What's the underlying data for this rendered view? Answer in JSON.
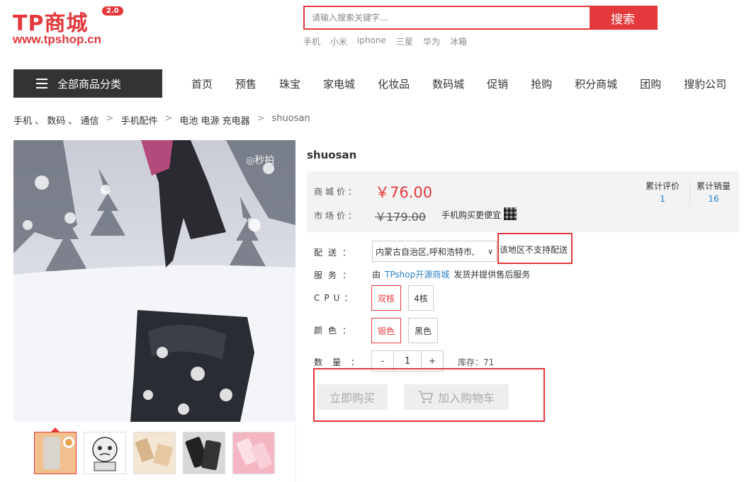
{
  "logo": {
    "title": "TP商城",
    "badge": "2.0",
    "url": "www.tpshop.cn"
  },
  "search": {
    "placeholder": "请输入搜索关键字...",
    "button": "搜索",
    "hot_words": [
      "手机",
      "小米",
      "iphone",
      "三星",
      "华为",
      "冰箱"
    ]
  },
  "nav": {
    "all_categories": "全部商品分类",
    "items": [
      "首页",
      "预售",
      "珠宝",
      "家电城",
      "化妆品",
      "数码城",
      "促销",
      "抢购",
      "积分商城",
      "团购",
      "搜豹公司"
    ]
  },
  "breadcrumb": [
    "手机 、 数码 、 通信",
    "手机配件",
    "电池 电源 充电器",
    "shuosan"
  ],
  "thumbnail_arrow_icon": "triangle-up-icon",
  "product": {
    "title": "shuosan",
    "shop_price_label": "商城价：",
    "shop_price": "￥76.00",
    "market_price_label": "市场价：",
    "market_price": "￥179.00",
    "mobile_cheap": "手机购买更便宜",
    "review_label": "累计评价",
    "review_count": "1",
    "sales_label": "累计销量",
    "sales_count": "16",
    "delivery_label": "配送：",
    "delivery_address": "内蒙古自治区,呼和浩特市,",
    "no_delivery": "该地区不支持配送",
    "service_label": "服务：",
    "service_prefix": "由",
    "service_link": "TPshop开源商城",
    "service_suffix": "发货并提供售后服务",
    "cpu_label": "CPU：",
    "cpu_options": [
      "双核",
      "4核"
    ],
    "cpu_selected": "双核",
    "color_label": "颜色：",
    "color_options": [
      "银色",
      "黑色"
    ],
    "color_selected": "银色",
    "qty_label": "数量：",
    "qty_minus": "-",
    "qty_value": "1",
    "qty_plus": "+",
    "stock": "库存：71",
    "buy_now": "立即购买",
    "add_cart": "加入购物车"
  },
  "colors": {
    "accent": "#e4393c",
    "link": "#2a82c8"
  }
}
